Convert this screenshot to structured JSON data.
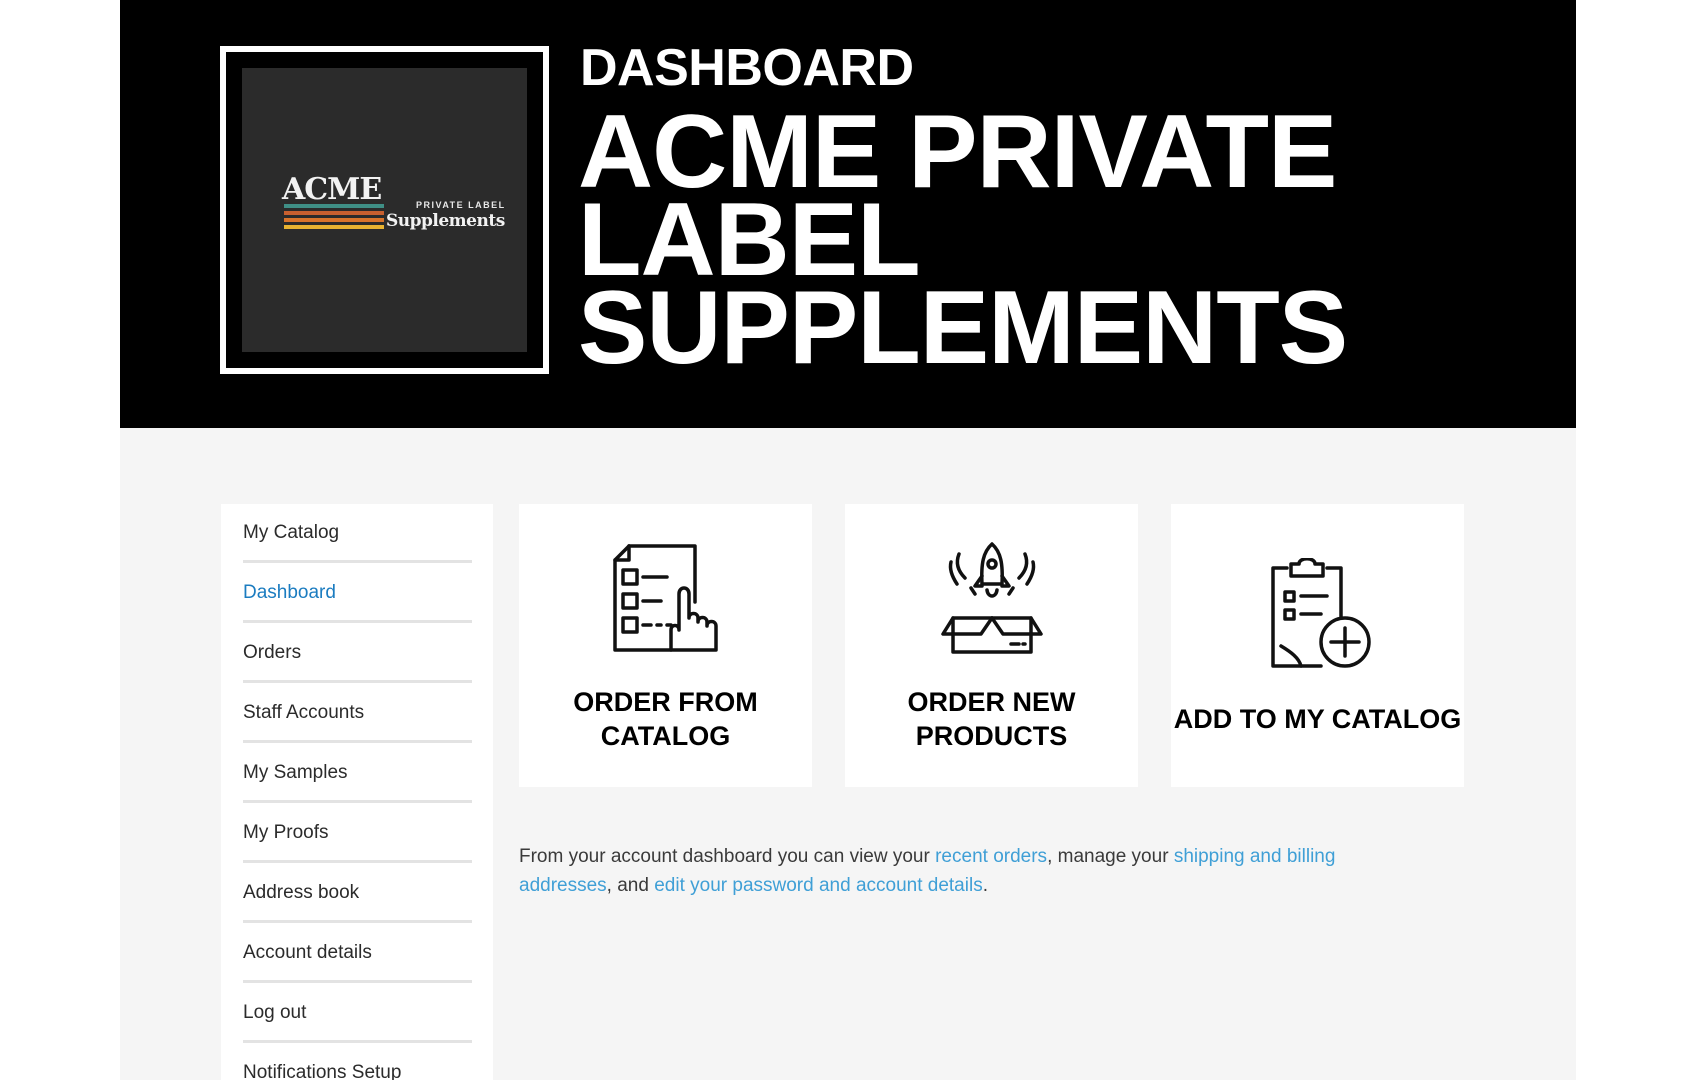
{
  "header": {
    "subtitle": "DASHBOARD",
    "title": "ACME PRIVATE LABEL SUPPLEMENTS"
  },
  "logo": {
    "brand": "ACME",
    "tagline": "PRIVATE LABEL",
    "product": "Supplements",
    "stripe_colors": [
      "#3f8f86",
      "#c8602f",
      "#d9742b",
      "#e8b331"
    ]
  },
  "sidebar": {
    "items": [
      {
        "label": "My Catalog"
      },
      {
        "label": "Dashboard",
        "active": true
      },
      {
        "label": "Orders"
      },
      {
        "label": "Staff Accounts"
      },
      {
        "label": "My Samples"
      },
      {
        "label": "My Proofs"
      },
      {
        "label": "Address book"
      },
      {
        "label": "Account details"
      },
      {
        "label": "Log out"
      },
      {
        "label": "Notifications Setup"
      }
    ]
  },
  "cards": [
    {
      "label_line1": "ORDER FROM",
      "label_line2": "CATALOG",
      "icon": "checklist-pointer-icon"
    },
    {
      "label_line1": "ORDER NEW",
      "label_line2": "PRODUCTS",
      "icon": "rocket-box-icon"
    },
    {
      "label": "ADD TO MY CATALOG",
      "icon": "clipboard-plus-icon"
    }
  ],
  "intro": {
    "t1": "From your account dashboard you can view your ",
    "link_orders": "recent orders",
    "t2": ", manage your ",
    "link_addresses": "shipping and billing addresses",
    "t3": ", and ",
    "link_account": "edit your password and account details",
    "t4": "."
  },
  "colors": {
    "accent_active": "#1b7cc0",
    "link": "#3f9fd6",
    "hero_bg": "#000000",
    "content_bg": "#f5f5f5"
  }
}
